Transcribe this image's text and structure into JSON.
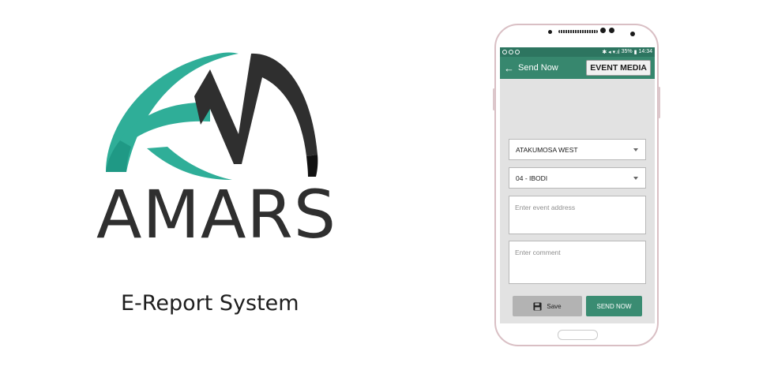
{
  "brand": {
    "name": "AMARS",
    "tagline": "E-Report System",
    "colors": {
      "teal": "#26a592",
      "dark": "#2b2b2b"
    }
  },
  "phone": {
    "status_bar": {
      "indicators": "✱ ◂ ▾.ıl",
      "battery": "35%",
      "time": "14:34"
    },
    "app_bar": {
      "back_icon": "arrow-left-icon",
      "title": "Send Now",
      "action_label": "EVENT MEDIA"
    },
    "form": {
      "lga_select": {
        "value": "ATAKUMOSA WEST"
      },
      "ward_select": {
        "value": "04 - IBODI"
      },
      "address_input": {
        "placeholder": "Enter event address"
      },
      "comment_input": {
        "placeholder": "Enter comment"
      }
    },
    "buttons": {
      "save_label": "Save",
      "save_icon": "floppy-disk-icon",
      "send_label": "SEND NOW"
    },
    "colors": {
      "app_bar": "#37876e",
      "status_bar": "#2d7560",
      "send_button": "#3a8c72"
    }
  }
}
